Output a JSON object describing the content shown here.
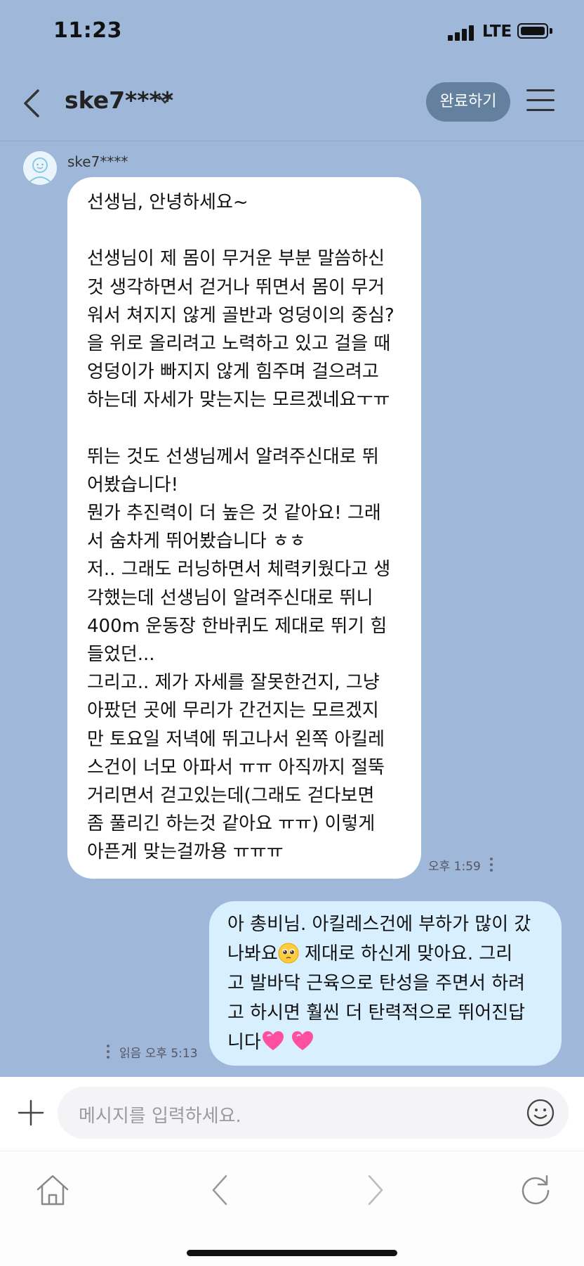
{
  "status_bar": {
    "time": "11:23",
    "network": "LTE"
  },
  "header": {
    "back_icon": "chevron-left-icon",
    "title": "ske7****",
    "done_label": "완료하기",
    "menu_icon": "hamburger-menu-icon"
  },
  "incoming": {
    "sender": "ske7****",
    "avatar_icon": "smiley-avatar-icon",
    "lines": [
      "선생님, 안녕하세요~",
      "",
      "선생님이 제 몸이 무거운 부분 말씀하신",
      "것 생각하면서 걷거나 뛰면서 몸이 무거",
      "워서 쳐지지 않게 골반과 엉덩이의 중심?",
      "을 위로 올리려고 노력하고 있고 걸을 때",
      "엉덩이가 빠지지 않게 힘주며 걸으려고",
      "하는데 자세가 맞는지는 모르겠네요ㅜㅠ",
      "",
      "뛰는 것도 선생님께서 알려주신대로 뛰",
      "어봤습니다!",
      "뭔가 추진력이 더 높은 것 같아요! 그래",
      "서 숨차게 뛰어봤습니다 ㅎㅎ",
      "저.. 그래도 러닝하면서 체력키웠다고 생",
      "각했는데 선생님이 알려주신대로 뛰니",
      "400m 운동장 한바퀴도 제대로 뛰기 힘",
      "들었던...",
      "그리고.. 제가 자세를 잘못한건지, 그냥",
      "아팠던 곳에 무리가 간건지는 모르겠지",
      "만 토요일 저녁에 뛰고나서 왼쪽 아킬레",
      "스건이 너모 아파서 ㅠㅠ 아직까지 절뚝",
      "거리면서 걷고있는데(그래도 걷다보면",
      "좀 풀리긴 하는것 같아요 ㅠㅠ) 이렇게",
      "아픈게 맞는걸까용 ㅠㅠㅠ"
    ],
    "time": "오후 1:59"
  },
  "outgoing": {
    "line1": "아 총비님. 아킬레스건에 부하가 많이 갔",
    "line2_pre": "나봐요",
    "line2_emoji": "pleading-face-emoji",
    "line2_post": " 제대로 하신게 맞아요. 그리",
    "line3": "고 발바닥 근육으로 탄성을 주면서 하려",
    "line4": "고 하시면 훨씬 더 탄력적으로 뛰어진답",
    "line5_pre": "니다",
    "line5_emoji": "heart-emoji",
    "read_label": "읽음",
    "time": "오후 5:13"
  },
  "input": {
    "placeholder": "메시지를 입력하세요.",
    "plus_icon": "plus-icon",
    "emoji_icon": "emoji-icon"
  },
  "browser_nav": {
    "icons": [
      "home-icon",
      "back-arrow-icon",
      "forward-arrow-icon",
      "refresh-icon"
    ]
  },
  "colors": {
    "background": "#9fb7d8",
    "incoming_bubble": "#ffffff",
    "outgoing_bubble": "#d8efff",
    "done_button": "#64809f",
    "heart": "#ff4fa3"
  }
}
